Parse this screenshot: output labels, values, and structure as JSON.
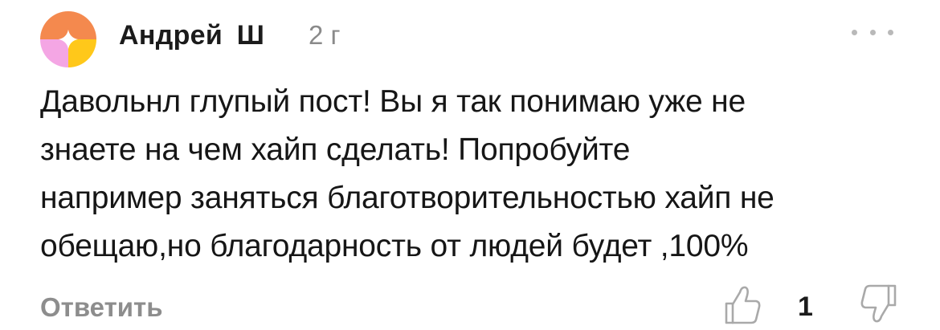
{
  "comment": {
    "author": "Андрей Ш",
    "timestamp": "2 г",
    "text_lines": [
      "Давольнл глупый пост! Вы я так понимаю уже не",
      "знаете на чем хайп сделать! Попробуйте",
      "например заняться благотворительностью хайп не",
      "обещаю,но благодарность от людей будет ,100%"
    ],
    "reply_label": "Ответить",
    "like_count": "1"
  },
  "icons": {
    "avatar": "avatar",
    "more": "more-dots-icon",
    "like": "thumbs-up-icon",
    "dislike": "thumbs-down-icon"
  },
  "colors": {
    "avatar_top": "#f4894e",
    "avatar_left": "#f4a6e4",
    "avatar_right": "#ffc81a",
    "muted_text": "#8d8d8d"
  }
}
